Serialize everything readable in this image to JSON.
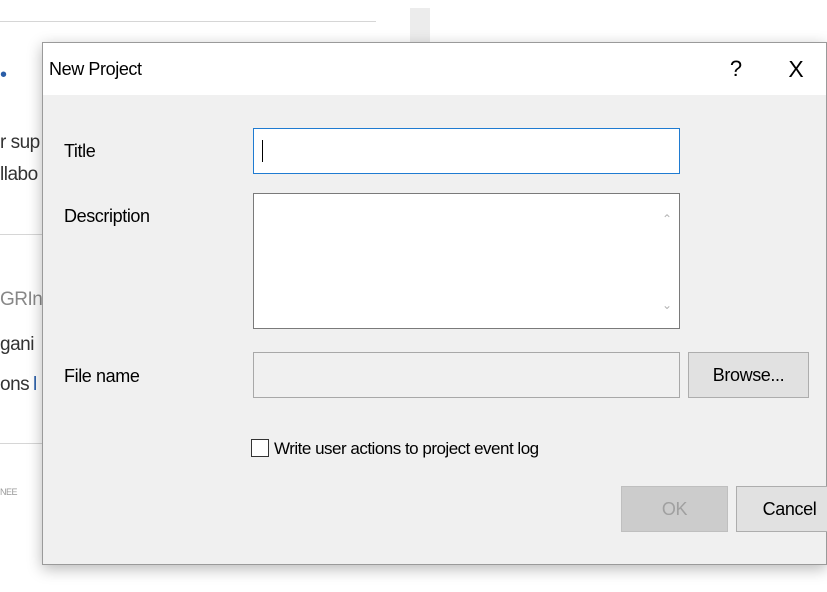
{
  "background": {
    "fragments": [
      {
        "text": "r sup",
        "link": false
      },
      {
        "text": "llabo",
        "link": false
      },
      {
        "text": "GRIn",
        "link": false
      },
      {
        "text": "gani",
        "link": false
      },
      {
        "text": "ons",
        "link": false
      },
      {
        "text": "l",
        "link": true
      },
      {
        "text": "NEE",
        "link": false
      }
    ]
  },
  "dialog": {
    "title": "New Project",
    "help_label": "?",
    "close_label": "X",
    "fields": {
      "title_label": "Title",
      "title_value": "",
      "description_label": "Description",
      "description_value": "",
      "filename_label": "File name",
      "filename_value": ""
    },
    "browse_label": "Browse...",
    "checkbox_label": "Write user actions to project event log",
    "checkbox_checked": false,
    "ok_label": "OK",
    "cancel_label": "Cancel"
  },
  "icons": {
    "scroll_up": "chevron-up-icon",
    "scroll_down": "chevron-down-icon"
  },
  "colors": {
    "dialog_bg": "#f0f0f0",
    "focus_border": "#1f7bd1",
    "link": "#2a5ea8"
  }
}
